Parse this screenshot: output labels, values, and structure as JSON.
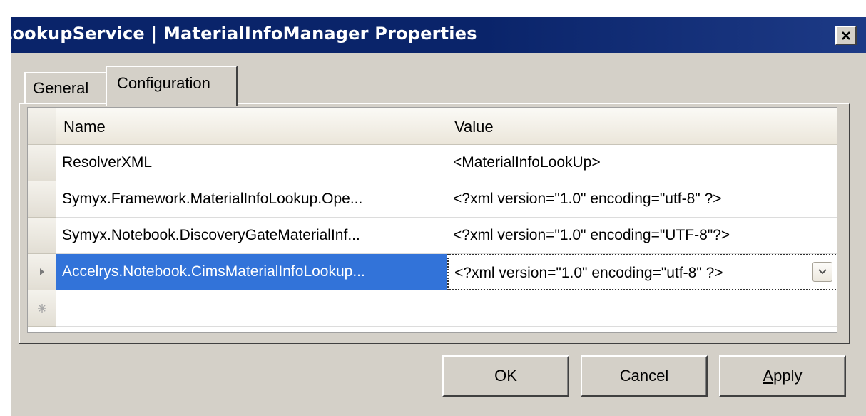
{
  "window": {
    "title": "LookupService | MaterialInfoManager Properties",
    "close_icon": "close-icon"
  },
  "tabs": [
    {
      "label": "General",
      "active": false
    },
    {
      "label": "Configuration",
      "active": true
    }
  ],
  "grid": {
    "columns": [
      "Name",
      "Value"
    ],
    "rows": [
      {
        "name": "ResolverXML",
        "value": "<MaterialInfoLookUp>"
      },
      {
        "name": "Symyx.Framework.MaterialInfoLookup.Ope...",
        "value": "<?xml version=\"1.0\" encoding=\"utf-8\" ?>"
      },
      {
        "name": "Symyx.Notebook.DiscoveryGateMaterialInf...",
        "value": "<?xml version=\"1.0\" encoding=\"UTF-8\"?>"
      },
      {
        "name": "Accelrys.Notebook.CimsMaterialInfoLookup...",
        "value": "<?xml version=\"1.0\" encoding=\"utf-8\" ?>"
      }
    ],
    "selected_row": 3,
    "current_row_icon": "triangle-right-icon",
    "new_row_icon": "asterisk-icon",
    "dropdown_icon": "chevron-down-icon",
    "colors": {
      "selection": "#3273d9",
      "header": "#ebe6da"
    }
  },
  "buttons": {
    "ok": "OK",
    "cancel": "Cancel",
    "apply_prefix": "",
    "apply_underlined": "A",
    "apply_rest": "pply"
  },
  "colors": {
    "titlebar": "#0a246a",
    "dialog": "#d4d0c8"
  }
}
